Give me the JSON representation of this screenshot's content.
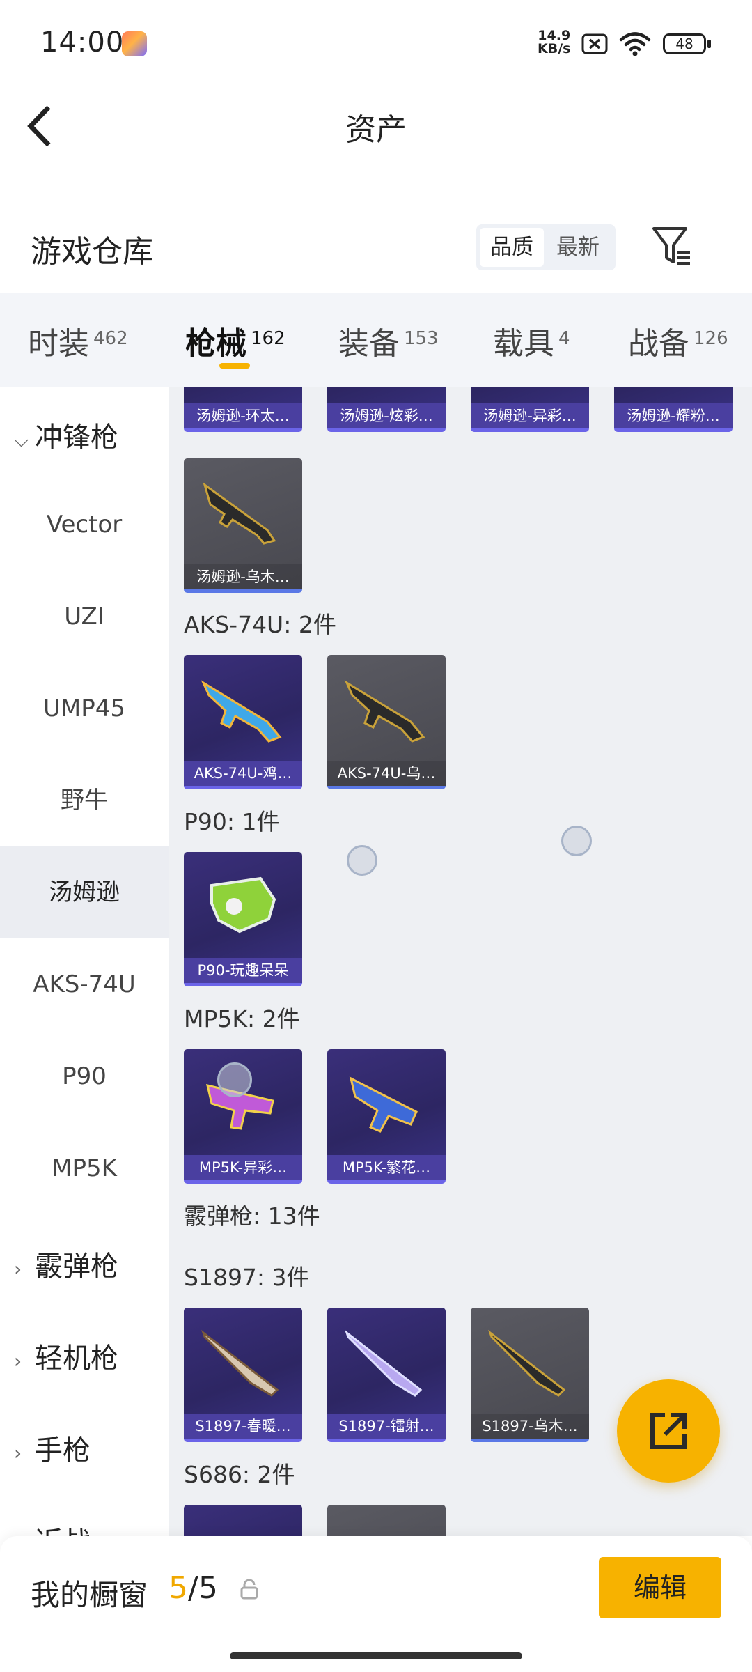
{
  "status_bar": {
    "time": "14:00",
    "net_speed_value": "14.9",
    "net_speed_unit": "KB/s",
    "battery": "48"
  },
  "header": {
    "title": "资产",
    "back_icon": "chevron-left-icon"
  },
  "warehouse": {
    "title": "游戏仓库",
    "sort_options": [
      "品质",
      "最新"
    ],
    "sort_selected": "品质",
    "filter_icon": "filter-icon"
  },
  "tabs": [
    {
      "label": "时装",
      "count": "462"
    },
    {
      "label": "枪械",
      "count": "162"
    },
    {
      "label": "装备",
      "count": "153"
    },
    {
      "label": "载具",
      "count": "4"
    },
    {
      "label": "战备",
      "count": "126"
    }
  ],
  "active_tab": "枪械",
  "sidebar": {
    "categories": [
      {
        "label": "冲锋枪",
        "expanded": true
      },
      {
        "label": "霰弹枪",
        "expanded": false
      },
      {
        "label": "轻机枪",
        "expanded": false
      },
      {
        "label": "手枪",
        "expanded": false
      },
      {
        "label": "近战",
        "expanded": false
      }
    ],
    "items": [
      "Vector",
      "UZI",
      "UMP45",
      "野牛",
      "汤姆逊",
      "AKS-74U",
      "P90",
      "MP5K"
    ],
    "active_item": "汤姆逊"
  },
  "content": {
    "top_row_cards": [
      "汤姆逊-环太…",
      "汤姆逊-炫彩…",
      "汤姆逊-异彩…",
      "汤姆逊-耀粉…"
    ],
    "thompson_extra": [
      "汤姆逊-乌木…"
    ],
    "groups": [
      {
        "label": "AKS-74U: 2件",
        "cards": [
          "AKS-74U-鸡…",
          "AKS-74U-乌…"
        ]
      },
      {
        "label": "P90: 1件",
        "cards": [
          "P90-玩趣呆呆"
        ]
      },
      {
        "label": "MP5K: 2件",
        "cards": [
          "MP5K-异彩…",
          "MP5K-繁花…"
        ]
      },
      {
        "label": "霰弹枪: 13件",
        "cards": []
      },
      {
        "label": "S1897: 3件",
        "cards": [
          "S1897-春暖…",
          "S1897-镭射…",
          "S1897-乌木…"
        ]
      },
      {
        "label": "S686: 2件",
        "cards": []
      }
    ]
  },
  "fab": {
    "icon": "share-external-icon"
  },
  "bottom": {
    "showcase_label": "我的橱窗",
    "showcase_current": "5",
    "showcase_sep": "/",
    "showcase_total": "5",
    "edit_label": "编辑"
  },
  "colors": {
    "accent": "#f7b200",
    "rare_purple": "#3a2f7a",
    "common_gray": "#55555c"
  }
}
